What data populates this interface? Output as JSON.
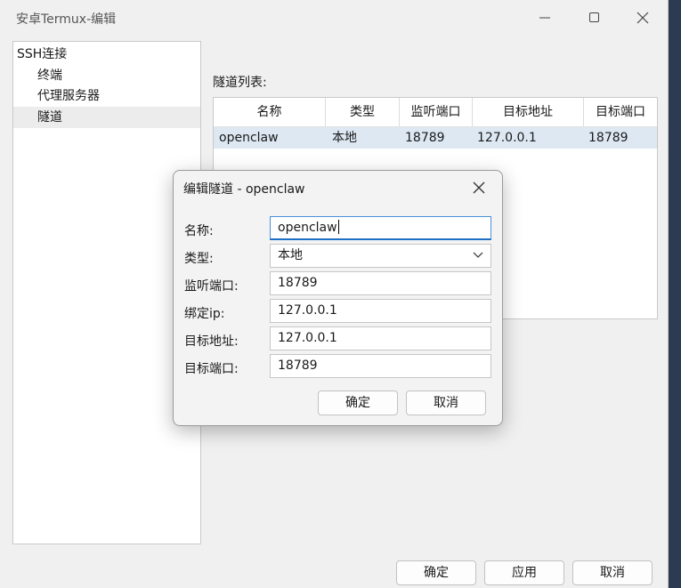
{
  "window": {
    "title": "安卓Termux-编辑"
  },
  "tree": {
    "items": [
      {
        "label": "SSH连接"
      },
      {
        "label": "终端"
      },
      {
        "label": "代理服务器"
      },
      {
        "label": "隧道"
      }
    ]
  },
  "tunnel_list": {
    "label": "隧道列表:",
    "columns": [
      "名称",
      "类型",
      "监听端口",
      "目标地址",
      "目标端口"
    ],
    "rows": [
      [
        "openclaw",
        "本地",
        "18789",
        "127.0.0.1",
        "18789"
      ]
    ]
  },
  "footer": {
    "ok_label": "确定",
    "apply_label": "应用",
    "cancel_label": "取消"
  },
  "dialog": {
    "title": "编辑隧道 - openclaw",
    "fields": {
      "name": {
        "label": "名称:",
        "value": "openclaw"
      },
      "type": {
        "label": "类型:",
        "value": "本地"
      },
      "listen_port": {
        "label": "监听端口:",
        "value": "18789"
      },
      "bind_ip": {
        "label": "绑定ip:",
        "value": "127.0.0.1"
      },
      "target_addr": {
        "label": "目标地址:",
        "value": "127.0.0.1"
      },
      "target_port": {
        "label": "目标端口:",
        "value": "18789"
      }
    },
    "ok_label": "确定",
    "cancel_label": "取消"
  },
  "icons": {
    "minimize": "minimize-icon",
    "maximize": "maximize-icon",
    "close": "close-icon",
    "dropdown": "chevron-down-icon"
  }
}
